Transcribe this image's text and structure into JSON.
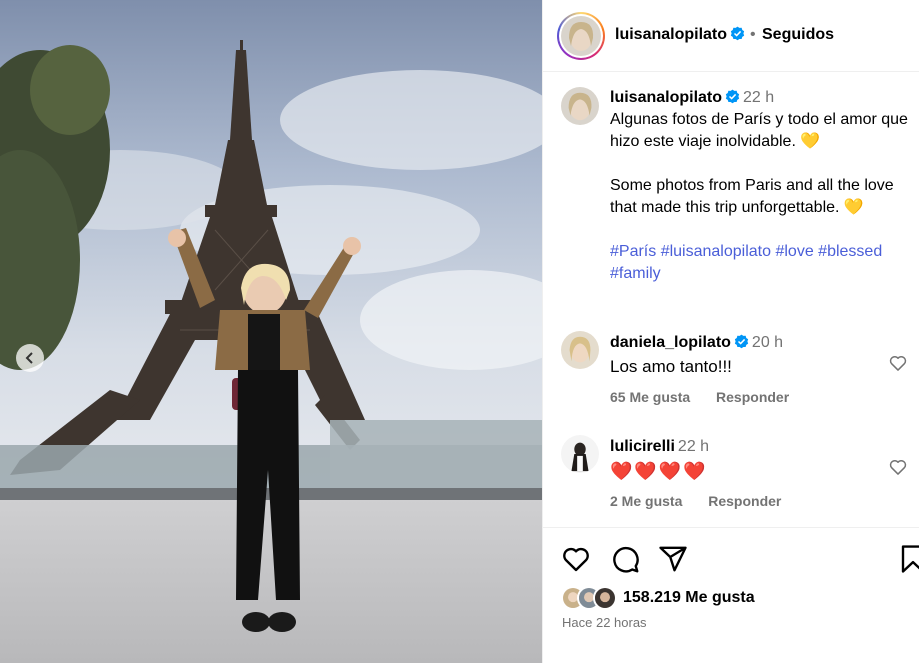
{
  "post": {
    "author": "luisanalopilato",
    "follow_status": "Seguidos",
    "separator": "•"
  },
  "caption": {
    "username": "luisanalopilato",
    "time": "22 h",
    "text_es": "Algunas fotos de París y todo el amor que hizo este viaje inolvidable.",
    "text_en": "Some photos from Paris and all the love that made this trip unforgettable.",
    "heart_emoji": "💛",
    "hashtags": [
      "#París",
      "#luisanalopilato",
      "#love",
      "#blessed",
      "#family"
    ]
  },
  "comments": [
    {
      "username": "daniela_lopilato",
      "verified": true,
      "time": "20 h",
      "text": "Los amo tanto!!!",
      "likes": "65 Me gusta",
      "reply": "Responder"
    },
    {
      "username": "lulicirelli",
      "verified": false,
      "time": "22 h",
      "text": "❤️❤️❤️❤️",
      "likes": "2 Me gusta",
      "reply": "Responder"
    }
  ],
  "footer": {
    "likes": "158.219 Me gusta",
    "posted": "Hace 22 horas"
  },
  "icons": {
    "like": "heart-outline-icon",
    "comment": "comment-bubble-icon",
    "share": "paper-plane-icon",
    "save": "bookmark-icon",
    "verified": "verified-badge-icon",
    "carousel_prev": "chevron-left-icon"
  },
  "colors": {
    "verified": "#0095f6",
    "hashtag": "#4a5ed8",
    "secondary_text": "#737373",
    "divider": "#efefef"
  }
}
